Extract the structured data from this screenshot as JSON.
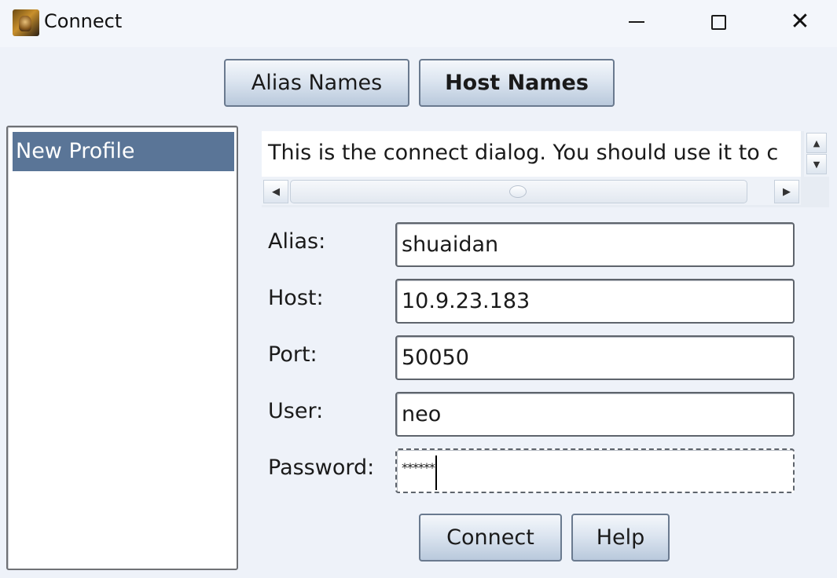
{
  "window": {
    "title": "Connect",
    "controls": {
      "minimize": "minimize",
      "maximize": "maximize",
      "close": "✕"
    }
  },
  "tabs": {
    "alias_names": "Alias Names",
    "host_names": "Host Names",
    "active": "Host Names"
  },
  "profiles": {
    "items": [
      "New Profile"
    ],
    "selected": "New Profile"
  },
  "info": {
    "text": "This is the connect dialog. You should use it to c"
  },
  "form": {
    "alias": {
      "label": "Alias:",
      "value": "shuaidan"
    },
    "host": {
      "label": "Host:",
      "value": "10.9.23.183"
    },
    "port": {
      "label": "Port:",
      "value": "50050"
    },
    "user": {
      "label": "User:",
      "value": "neo"
    },
    "password": {
      "label": "Password:",
      "value": "******"
    }
  },
  "buttons": {
    "connect": "Connect",
    "help": "Help"
  },
  "colors": {
    "background": "#eef2f9",
    "selection": "#5a7597",
    "button_border": "#6a7a8f"
  }
}
